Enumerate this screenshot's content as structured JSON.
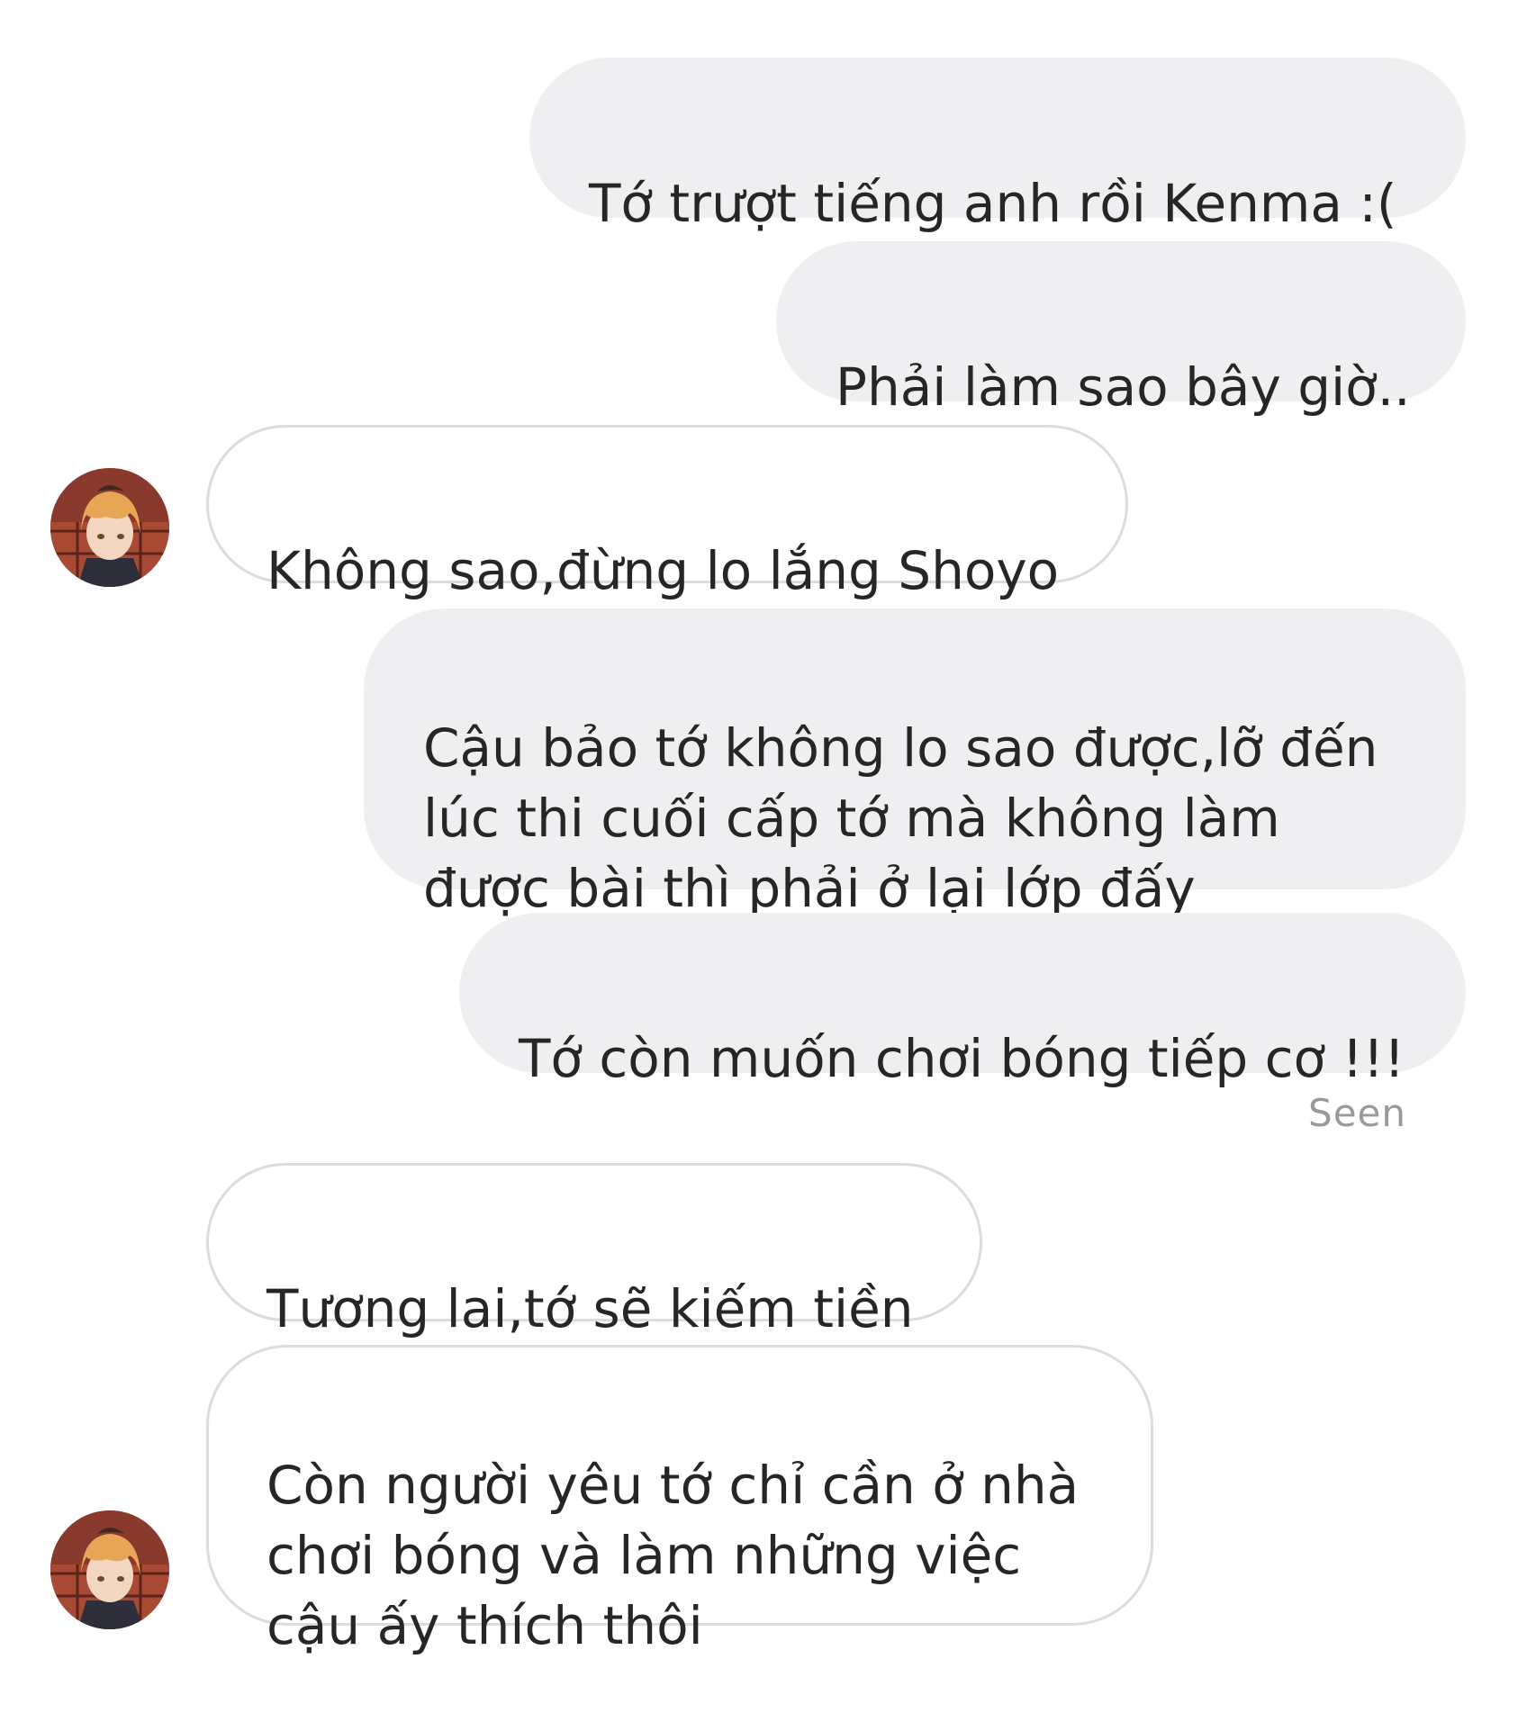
{
  "conversation": {
    "messages": [
      {
        "direction": "outgoing",
        "text": "Tớ trượt tiếng anh rồi Kenma :("
      },
      {
        "direction": "outgoing",
        "text": "Phải làm sao bây giờ.."
      },
      {
        "direction": "incoming",
        "text": "Không sao,đừng lo lắng Shoyo"
      },
      {
        "direction": "outgoing",
        "text": "Cậu bảo tớ không lo sao được,lỡ đến\nlúc thi cuối cấp tớ mà không làm\nđược bài thì phải ở lại lớp đấy"
      },
      {
        "direction": "outgoing",
        "text": "Tớ còn muốn chơi bóng tiếp cơ !!!"
      },
      {
        "direction": "incoming",
        "text": "Tương lai,tớ sẽ kiếm tiền"
      },
      {
        "direction": "incoming",
        "text": "Còn người yêu tớ chỉ cần ở nhà\nchơi bóng và làm những việc\ncậu ấy thích thôi"
      }
    ],
    "seen_label": "Seen"
  },
  "colors": {
    "outgoing_bubble": "#efeff2",
    "incoming_border": "#dcdcde",
    "text": "#262626",
    "seen": "#9a9a9e"
  },
  "icons": {
    "avatar": "contact-avatar-orange-hair"
  }
}
